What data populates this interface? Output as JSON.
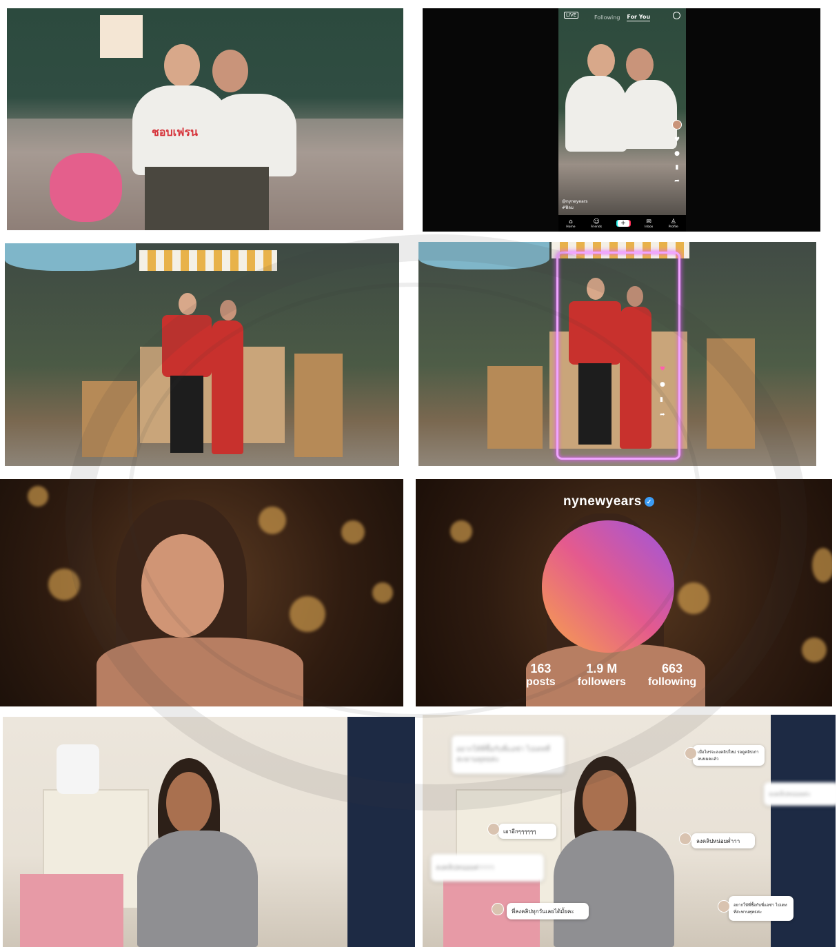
{
  "panels": {
    "tiktok_mockup": {
      "top_tabs": [
        "Following",
        "For You"
      ],
      "active_tab": "For You",
      "live_label": "LIVE",
      "side_icons": [
        "avatar-icon",
        "heart-icon",
        "comment-icon",
        "bookmark-icon",
        "share-icon"
      ],
      "username": "@nyneyears",
      "caption": "#ฟิลม",
      "nav_items": [
        {
          "label": "Home",
          "icon": "home-icon"
        },
        {
          "label": "Friends",
          "icon": "friends-icon"
        },
        {
          "label": "",
          "icon": "plus-icon"
        },
        {
          "label": "Inbox",
          "icon": "inbox-icon"
        },
        {
          "label": "Profile",
          "icon": "profile-icon"
        }
      ]
    },
    "instagram_profile": {
      "username": "nynewyears",
      "stats": [
        {
          "value": "163",
          "label": "posts"
        },
        {
          "value": "1.9 M",
          "label": "followers"
        },
        {
          "value": "663",
          "label": "following"
        }
      ]
    },
    "comments": [
      {
        "text": "อยากให้พี่ซื้อกับพี่แอซ่า ไปเดทที่สะพานพุทธค่ะ",
        "blurred": true
      },
      {
        "text": "เมื่อไหร่จะลงคลิปใหม่ รอดูคลิปเก่าจนหมดแล้ว",
        "blurred": false
      },
      {
        "text": "ลงคลิปหน่อยค่ะ",
        "blurred": true
      },
      {
        "text": "เอาอีกๆๆๆๆๆๆ",
        "blurred": false
      },
      {
        "text": "ลงคลิปหน่อยค่ำาา",
        "blurred": false
      },
      {
        "text": "ลงคลิปหน่อยค่าาาา",
        "blurred": true
      },
      {
        "text": "พี่ลงคลิปทุกวันเลยได้มั้ยคะ",
        "blurred": false
      },
      {
        "text": "อยากให้พี่ซื้อกับพี่แอซ่า ไปเดทที่สะพานพุทธค่ะ",
        "blurred": false
      }
    ],
    "tshirt_text": "ชอบเฟรน"
  },
  "colors": {
    "neon_frame": "#f0a6ff",
    "verified": "#3b9cf6",
    "tiktok_cyan": "#25f4ee",
    "tiktok_red": "#fe2c55"
  }
}
